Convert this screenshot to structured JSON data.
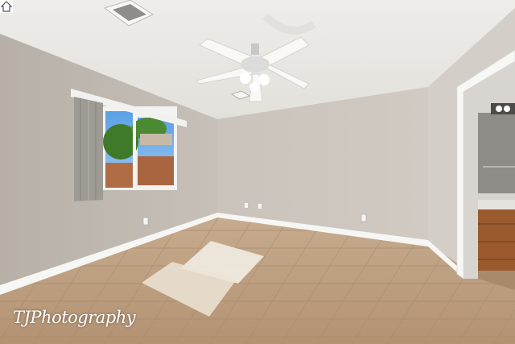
{
  "scene": {
    "description_icons": [
      "ceiling-fan-icon",
      "air-vent-icon",
      "window-icon",
      "electrical-outlet-icon",
      "home-logo-icon"
    ],
    "colors": {
      "ceiling": "#e9e8e4",
      "left_wall": "#bdb6ad",
      "back_wall": "#cfc9c1",
      "right_wall": "#d6d1ca",
      "floor": "#bf9e7c",
      "baseboard": "#f4f4f2",
      "cabinet": "#9a5a2e"
    }
  },
  "watermark": {
    "text": "TJPhotography"
  }
}
